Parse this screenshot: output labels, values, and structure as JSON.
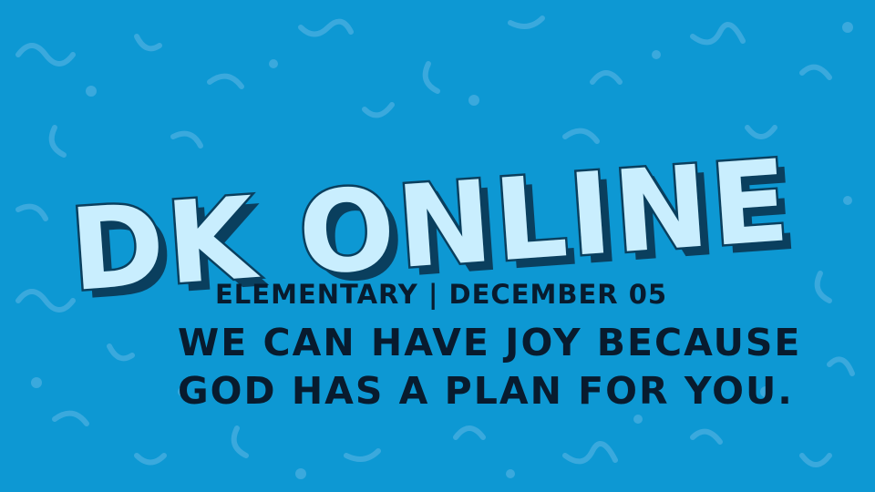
{
  "background_color": "#0d98d3",
  "pattern_color": "#3aa9dd",
  "title": "DK ONLINE",
  "title_fill_color": "#c9eefe",
  "title_outline_color": "#0a3f5e",
  "meta_line": "ELEMENTARY | DECEMBER 05",
  "message": {
    "line_1": "WE CAN HAVE JOY BECAUSE",
    "line_2": "GOD HAS A PLAN FOR YOU."
  }
}
